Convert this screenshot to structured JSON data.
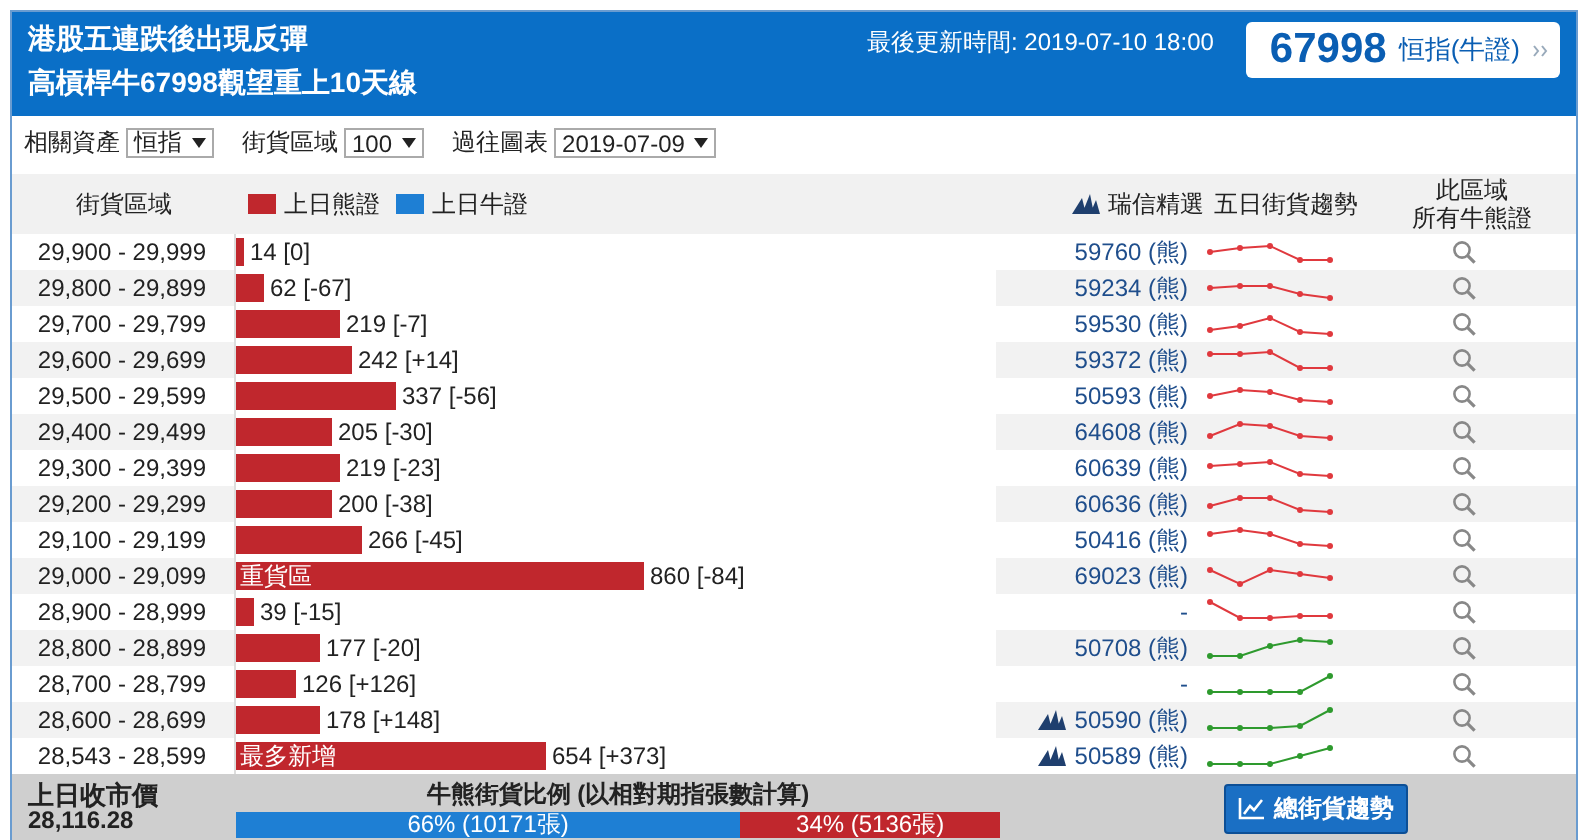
{
  "header": {
    "title_lines": [
      "港股五連跌後出現反彈",
      "高槓桿牛67998觀望重上10天線"
    ],
    "updated": "最後更新時間: 2019-07-10 18:00",
    "code": "67998",
    "code_label": "恒指(牛證)"
  },
  "filters": [
    {
      "label": "相關資產",
      "value": "恒指"
    },
    {
      "label": "街貨區域",
      "value": "100"
    },
    {
      "label": "過往圖表",
      "value": "2019-07-09"
    }
  ],
  "table": {
    "columns": {
      "range": "街貨區域",
      "legend": [
        {
          "label": "上日熊證",
          "color": "#c0272d"
        },
        {
          "label": "上日牛證",
          "color": "#1e7fd4"
        }
      ],
      "pick": "瑞信精選",
      "trend": "五日街貨趨勢",
      "all": [
        "此區域",
        "所有牛熊證"
      ]
    },
    "rows": [
      {
        "range": "29,900 - 29,999",
        "amount": "14 [0]",
        "warrant": "59760 (熊)",
        "featured": false,
        "trend": {
          "color": "#e0393e"
        }
      },
      {
        "range": "29,800 - 29,899",
        "amount": "62 [-67]",
        "warrant": "59234 (熊)",
        "featured": false,
        "trend": {
          "color": "#e0393e"
        }
      },
      {
        "range": "29,700 - 29,799",
        "amount": "219 [-7]",
        "warrant": "59530 (熊)",
        "featured": false,
        "trend": {
          "color": "#e0393e"
        }
      },
      {
        "range": "29,600 - 29,699",
        "amount": "242 [+14]",
        "warrant": "59372 (熊)",
        "featured": false,
        "trend": {
          "color": "#e0393e"
        }
      },
      {
        "range": "29,500 - 29,599",
        "amount": "337 [-56]",
        "warrant": "50593 (熊)",
        "featured": false,
        "trend": {
          "color": "#e0393e"
        }
      },
      {
        "range": "29,400 - 29,499",
        "amount": "205 [-30]",
        "warrant": "64608 (熊)",
        "featured": false,
        "trend": {
          "color": "#e0393e"
        }
      },
      {
        "range": "29,300 - 29,399",
        "amount": "219 [-23]",
        "warrant": "60639 (熊)",
        "featured": false,
        "trend": {
          "color": "#e0393e"
        }
      },
      {
        "range": "29,200 - 29,299",
        "amount": "200 [-38]",
        "warrant": "60636 (熊)",
        "featured": false,
        "trend": {
          "color": "#e0393e"
        }
      },
      {
        "range": "29,100 - 29,199",
        "amount": "266 [-45]",
        "warrant": "50416 (熊)",
        "featured": false,
        "trend": {
          "color": "#e0393e"
        }
      },
      {
        "range": "29,000 - 29,099",
        "amount": "860 [-84]",
        "bar_label": "重貨區",
        "warrant": "69023 (熊)",
        "featured": false,
        "trend": {
          "color": "#e0393e"
        }
      },
      {
        "range": "28,900 - 28,999",
        "amount": "39 [-15]",
        "warrant": "-",
        "featured": false,
        "trend": {
          "color": "#e0393e"
        }
      },
      {
        "range": "28,800 - 28,899",
        "amount": "177 [-20]",
        "warrant": "50708 (熊)",
        "featured": false,
        "trend": {
          "color": "#2e9a2e"
        }
      },
      {
        "range": "28,700 - 28,799",
        "amount": "126 [+126]",
        "warrant": "-",
        "featured": false,
        "trend": {
          "color": "#2e9a2e"
        }
      },
      {
        "range": "28,600 - 28,699",
        "amount": "178 [+148]",
        "warrant": "50590 (熊)",
        "featured": true,
        "trend": {
          "color": "#2e9a2e"
        }
      },
      {
        "range": "28,543 - 28,599",
        "amount": "654 [+373]",
        "bar_label": "最多新增",
        "warrant": "50589 (熊)",
        "featured": true,
        "trend": {
          "color": "#2e9a2e"
        }
      }
    ]
  },
  "footer": {
    "close_label": "上日收市價",
    "close_value": "28,116.28",
    "ratio_title": "牛熊街貨比例 (以相對期指張數計算)",
    "bull": {
      "text": "66% (10171張)"
    },
    "bear": {
      "text": "34% (5136張)"
    },
    "button": "總街貨趨勢"
  }
}
